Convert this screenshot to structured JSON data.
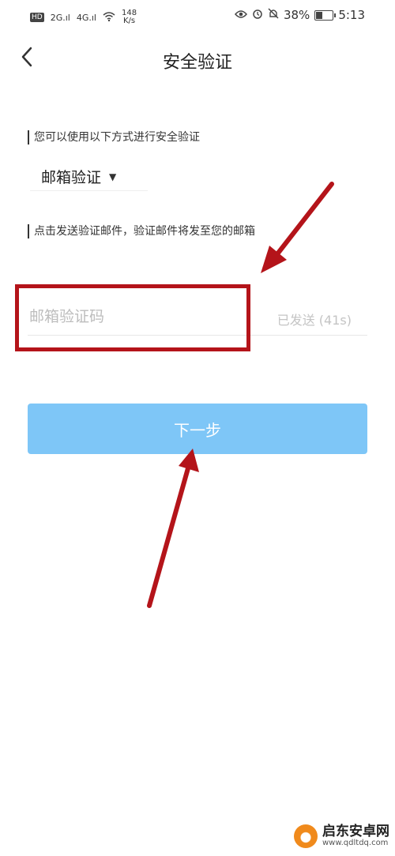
{
  "status_bar": {
    "hd": "HD",
    "net1": "2G",
    "net2": "4G",
    "speed": "148",
    "speed_unit": "K/s",
    "battery": "38%",
    "battery_level": 0.38,
    "time": "5:13"
  },
  "header": {
    "title": "安全验证"
  },
  "section1": {
    "label": "您可以使用以下方式进行安全验证"
  },
  "method": {
    "selected": "邮箱验证"
  },
  "section2": {
    "label": "点击发送验证邮件，验证邮件将发至您的邮箱"
  },
  "code": {
    "placeholder": "邮箱验证码",
    "sent_label": "已发送 (41s)"
  },
  "next_button": {
    "label": "下一步"
  },
  "annotation": {
    "color": "#b4141a"
  },
  "button_color": "#7ec6f7",
  "watermark": {
    "name": "启东安卓网",
    "url": "www.qdltdq.com"
  }
}
